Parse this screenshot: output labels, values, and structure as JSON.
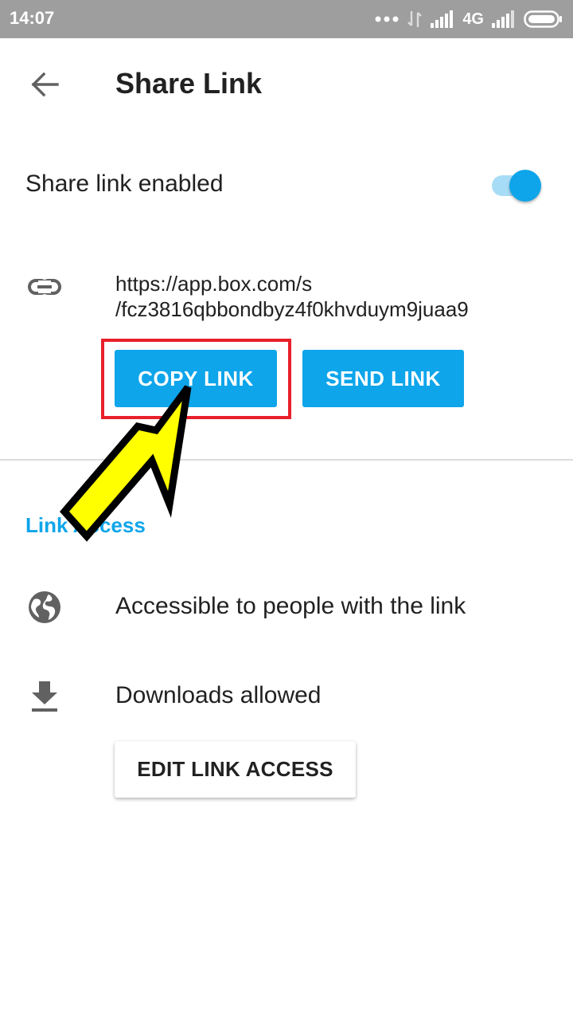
{
  "status_bar": {
    "time": "14:07",
    "network": "4G",
    "icons": [
      "more-dots-icon",
      "data-arrows-icon",
      "signal-icon",
      "signal-icon",
      "battery-icon"
    ]
  },
  "header": {
    "back_icon": "arrow-back-icon",
    "title": "Share Link"
  },
  "share_toggle": {
    "label": "Share link enabled",
    "enabled": true
  },
  "link": {
    "icon": "link-icon",
    "url_line1": "https://app.box.com/s",
    "url_line2": "/fcz3816qbbondbyz4f0khvduym9juaa9"
  },
  "actions": {
    "copy_label": "COPY LINK",
    "send_label": "SEND LINK"
  },
  "link_access": {
    "section_title": "Link Access",
    "access_text": "Accessible to people with the link",
    "download_text": "Downloads allowed",
    "edit_label": "EDIT LINK ACCESS"
  },
  "colors": {
    "accent": "#0ea5ea",
    "highlight": "#e8202a",
    "annotation_arrow": "#ffff00",
    "status_bar": "#9e9e9e"
  }
}
